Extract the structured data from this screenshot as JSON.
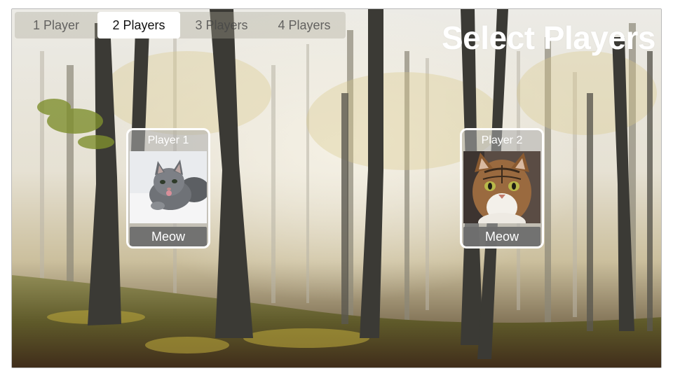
{
  "segments": {
    "options": [
      "1 Player",
      "2 Players",
      "3 Players",
      "4 Players"
    ],
    "selected_index": 1
  },
  "title": "Select Players",
  "players": [
    {
      "label": "Player 1",
      "button": "Meow",
      "avatar": "gray-kitten"
    },
    {
      "label": "Player 2",
      "button": "Meow",
      "avatar": "tabby-cat"
    }
  ],
  "colors": {
    "selected_segment_bg": "#ffffff",
    "card_border": "#ffffff",
    "button_bg": "#6e6e6e"
  }
}
